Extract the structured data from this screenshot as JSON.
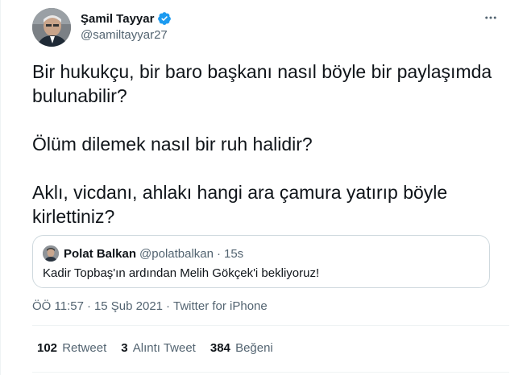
{
  "author": {
    "display_name": "Şamil Tayyar",
    "handle": "@samiltayyar27",
    "verified": true,
    "verified_color": "#1d9bf0"
  },
  "more_icon": "more-horizontal-icon",
  "tweet_text": [
    "Bir hukukçu, bir baro başkanı nasıl böyle bir paylaşımda bulunabilir?",
    "Ölüm dilemek nasıl bir ruh halidir?",
    "Aklı, vicdanı, ahlakı hangi ara çamura yatırıp böyle kirlettiniz?"
  ],
  "quoted_tweet": {
    "display_name": "Polat Balkan",
    "handle": "@polatbalkan",
    "separator": "·",
    "time": "15s",
    "text": "Kadir Topbaş'ın ardından Melih Gökçek'i bekliyoruz!"
  },
  "meta": {
    "time": "ÖÖ 11:57",
    "date": "15 Şub 2021",
    "separator": "·",
    "source": "Twitter for iPhone"
  },
  "stats": [
    {
      "count": "102",
      "label": "Retweet"
    },
    {
      "count": "3",
      "label": "Alıntı Tweet"
    },
    {
      "count": "384",
      "label": "Beğeni"
    }
  ]
}
